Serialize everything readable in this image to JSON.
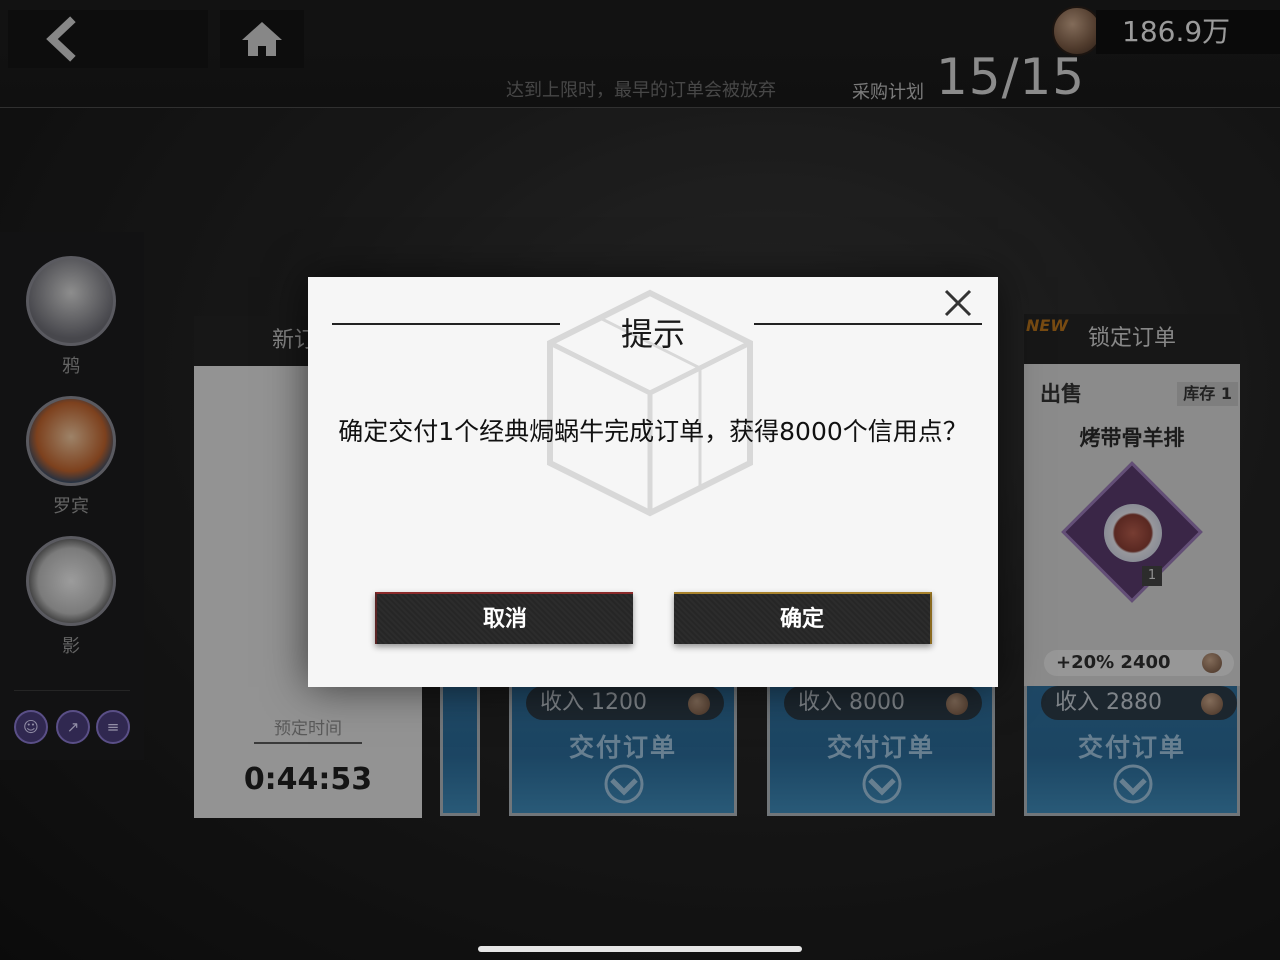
{
  "topbar": {
    "currency_value": "186.9万",
    "limit_hint": "达到上限时，最早的订单会被放弃",
    "plan_label": "采购计划",
    "plan_count": "15/15"
  },
  "characters": [
    {
      "name": "鸦"
    },
    {
      "name": "罗宾"
    },
    {
      "name": "影"
    }
  ],
  "new_order_card": {
    "title": "新订",
    "scheduled_label": "预定时间",
    "scheduled_time": "0:44:53"
  },
  "deliver_cards": [
    {
      "income": "收入  1200",
      "action": "交付订单"
    },
    {
      "income": "收入  8000",
      "action": "交付订单"
    },
    {
      "income": "收入  2880",
      "action": "交付订单"
    }
  ],
  "locked_order": {
    "new_tag": "NEW",
    "title": "锁定订单",
    "sale_label": "出售",
    "stock": "库存 1",
    "dish": "烤带骨羊排",
    "qty": "1",
    "bonus": "+20%  2400"
  },
  "dialog": {
    "title": "提示",
    "message": "确定交付1个经典焗蜗牛完成订单，获得8000个信用点？",
    "cancel_label": "取消",
    "confirm_label": "确定"
  }
}
